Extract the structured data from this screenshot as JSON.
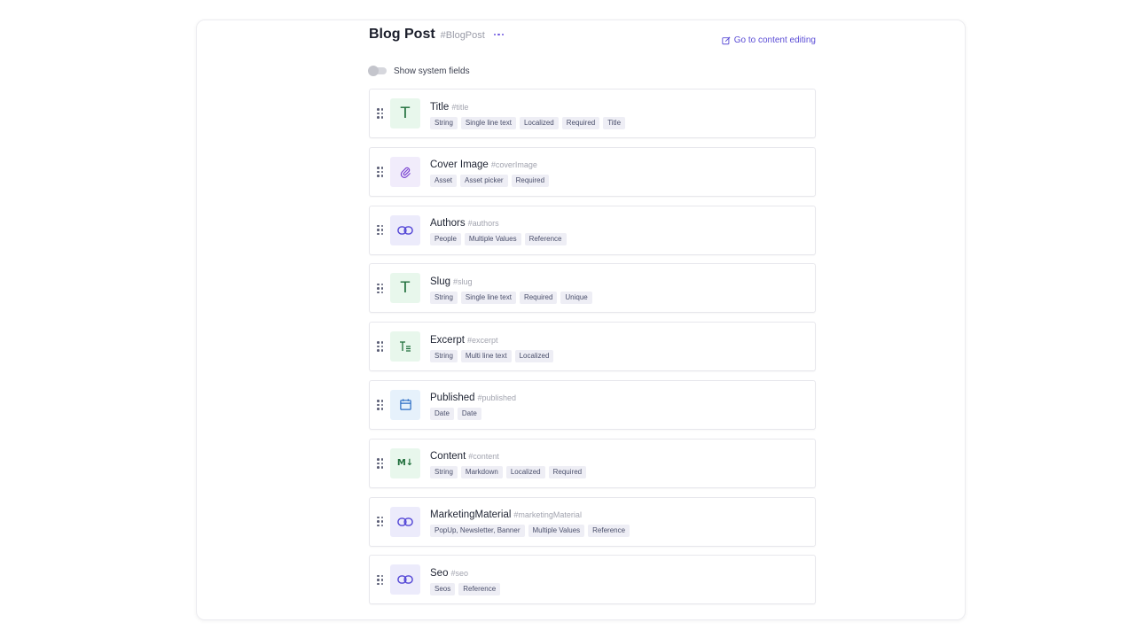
{
  "header": {
    "model_name": "Blog Post",
    "model_api_id": "#BlogPost",
    "edit_link": "Go to content editing"
  },
  "toggle": {
    "label": "Show system fields",
    "on": false
  },
  "fields": [
    {
      "name": "Title",
      "api": "#title",
      "icon": "text-icon",
      "tags": [
        "String",
        "Single line text",
        "Localized",
        "Required",
        "Title"
      ]
    },
    {
      "name": "Cover Image",
      "api": "#coverImage",
      "icon": "paperclip-icon",
      "tags": [
        "Asset",
        "Asset picker",
        "Required"
      ]
    },
    {
      "name": "Authors",
      "api": "#authors",
      "icon": "link-icon",
      "tags": [
        "People",
        "Multiple Values",
        "Reference"
      ]
    },
    {
      "name": "Slug",
      "api": "#slug",
      "icon": "text-icon",
      "tags": [
        "String",
        "Single line text",
        "Required",
        "Unique"
      ]
    },
    {
      "name": "Excerpt",
      "api": "#excerpt",
      "icon": "multiline-text-icon",
      "tags": [
        "String",
        "Multi line text",
        "Localized"
      ]
    },
    {
      "name": "Published",
      "api": "#published",
      "icon": "calendar-icon",
      "tags": [
        "Date",
        "Date"
      ]
    },
    {
      "name": "Content",
      "api": "#content",
      "icon": "markdown-icon",
      "tags": [
        "String",
        "Markdown",
        "Localized",
        "Required"
      ]
    },
    {
      "name": "MarketingMaterial",
      "api": "#marketingMaterial",
      "icon": "link-icon",
      "tags": [
        "PopUp, Newsletter, Banner",
        "Multiple Values",
        "Reference"
      ]
    },
    {
      "name": "Seo",
      "api": "#seo",
      "icon": "link-icon",
      "tags": [
        "Seos",
        "Reference"
      ]
    }
  ]
}
